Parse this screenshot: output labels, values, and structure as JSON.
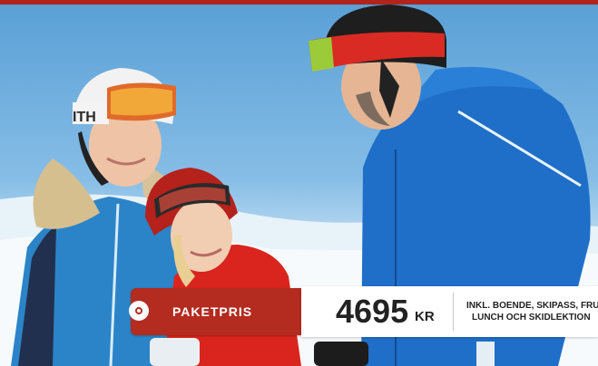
{
  "banner": {
    "price_tag": {
      "label": "PAKETPRIS"
    },
    "price": {
      "amount": "4695",
      "currency": "KR"
    },
    "includes": {
      "line1": "INKL. BOENDE, SKIPASS, FRU",
      "line2": "LUNCH OCH SKIDLEKTION"
    },
    "helmet_brand": "ITH",
    "colors": {
      "accent_red": "#b42b1f",
      "top_bar": "#b0241c"
    }
  }
}
